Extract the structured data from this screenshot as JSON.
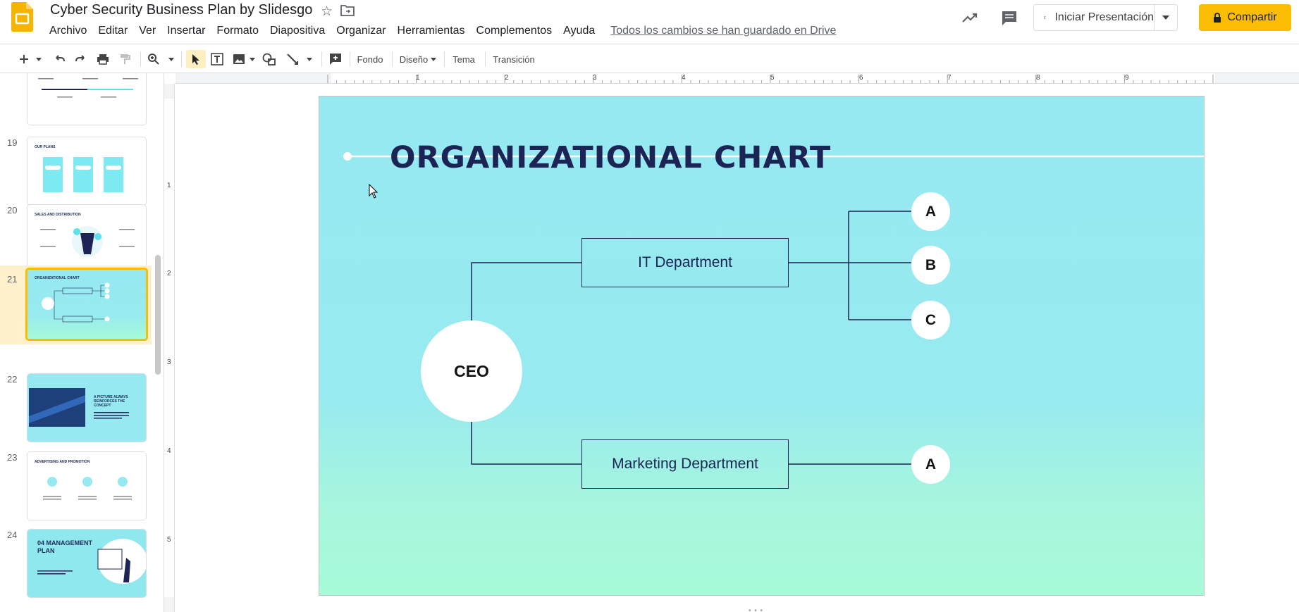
{
  "header": {
    "doc_title": "Cyber Security Business Plan by Slidesgo",
    "menu": [
      "Archivo",
      "Editar",
      "Ver",
      "Insertar",
      "Formato",
      "Diapositiva",
      "Organizar",
      "Herramientas",
      "Complementos",
      "Ayuda"
    ],
    "save_status": "Todos los cambios se han guardado en Drive",
    "present_label": "Iniciar Presentación",
    "share_label": "Compartir",
    "colors": {
      "logo": "#f4b400",
      "share": "#fbbc04"
    }
  },
  "toolbar": {
    "background_label": "Fondo",
    "design_label": "Diseño",
    "theme_label": "Tema",
    "transition_label": "Transición"
  },
  "filmstrip": {
    "slides": [
      {
        "number": "19",
        "title": "OUR PLANS"
      },
      {
        "number": "20",
        "title": "SALES AND DISTRIBUTION"
      },
      {
        "number": "21",
        "title": "ORGANIZATIONAL CHART",
        "selected": true
      },
      {
        "number": "22",
        "title": "A PICTURE ALWAYS REINFORCES THE CONCEPT"
      },
      {
        "number": "23",
        "title": "ADVERTISING AND PROMOTION"
      },
      {
        "number": "24",
        "title": "04 MANAGEMENT PLAN"
      }
    ]
  },
  "rulers": {
    "horizontal": [
      "1",
      "2",
      "3",
      "4",
      "5",
      "6",
      "7",
      "8",
      "9"
    ],
    "vertical": [
      "1",
      "2",
      "3",
      "4",
      "5"
    ]
  },
  "slide": {
    "title": "ORGANIZATIONAL CHART",
    "ceo": "CEO",
    "dept_it": "IT Department",
    "dept_marketing": "Marketing Department",
    "it_leaves": [
      "A",
      "B",
      "C"
    ],
    "marketing_leaves": [
      "A"
    ],
    "colors": {
      "navy": "#1b2454",
      "cyan": "#96e9f0",
      "mint": "#a7fbd8"
    }
  }
}
